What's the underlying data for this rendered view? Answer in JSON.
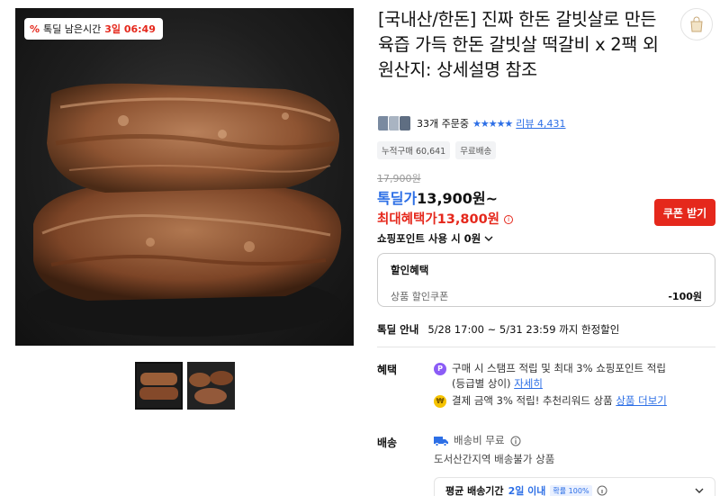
{
  "deal_badge": {
    "icon": "percent-icon",
    "label": "톡딜 남은시간",
    "remaining": "3일 06:49"
  },
  "product": {
    "title": "[국내산/한돈] 진짜 한돈 갈빗살로 만든 육즙 가득 한돈 갈빗살 떡갈비 x 2팩 외 원산지: 상세설명 참조"
  },
  "reviews": {
    "orders": "33개 주문중",
    "stars": "★★★★★",
    "review_label": "리뷰 4,431"
  },
  "chips": [
    "누적구매 60,641",
    "무료배송"
  ],
  "price": {
    "original": "17,900원",
    "deal_label": "톡딜가",
    "deal_value": "13,900원~",
    "max_label": "최대혜택가",
    "max_value": "13,800원",
    "coupon_button": "쿠폰 받기",
    "point_usage": "쇼핑포인트 사용 시 0원"
  },
  "discount": {
    "heading": "할인혜택",
    "item_label": "상품 할인쿠폰",
    "item_value": "-100원"
  },
  "deal_info": {
    "label": "톡딜 안내",
    "value": "5/28 17:00 ~ 5/31 23:59 까지 한정할인"
  },
  "benefits": {
    "label": "혜택",
    "item1_text": "구매 시 스탬프 적립 및 최대 3% 쇼핑포인트 적립",
    "item1_sub": "(등급별 상이)",
    "item1_link": "자세히",
    "item2_text": "결제 금액 3% 적립! 추천리워드 상품",
    "item2_link": "상품 더보기"
  },
  "shipping": {
    "label": "배송",
    "fee": "배송비 무료",
    "restriction": "도서산간지역 배송불가 상품",
    "period_label": "평균 배송기간",
    "period_value": "2일 이내",
    "period_tag": "확률 100%"
  },
  "colors": {
    "accent_red": "#e5281c",
    "accent_blue": "#2d6fe6"
  }
}
